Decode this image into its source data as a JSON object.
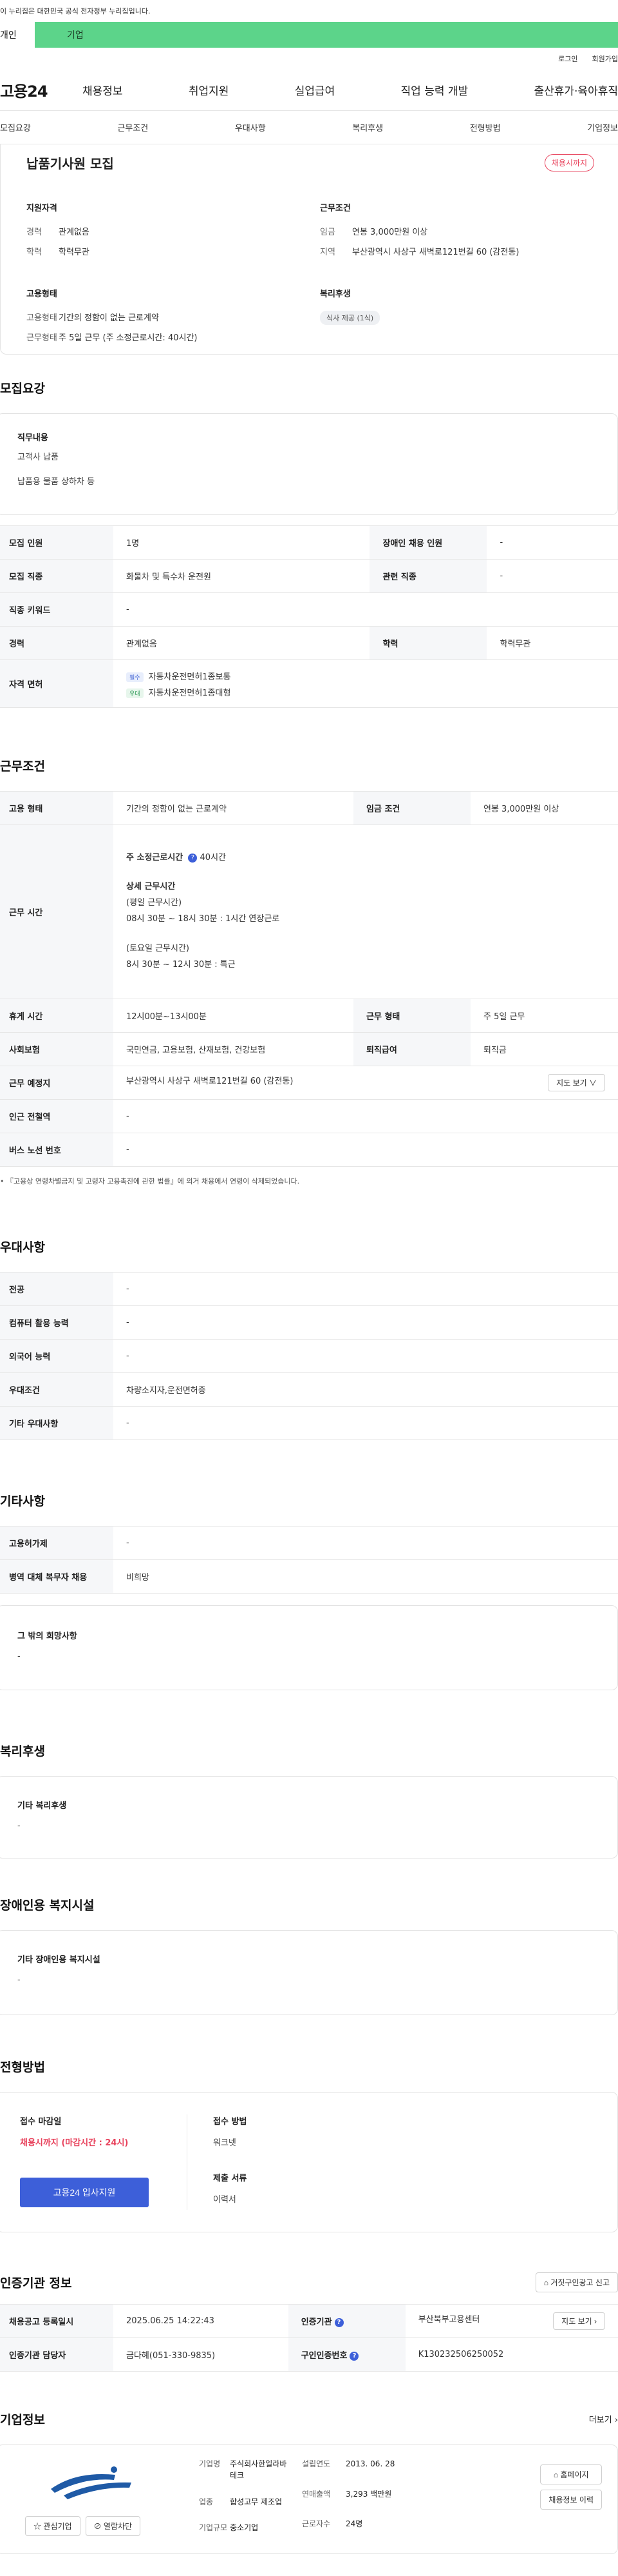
{
  "top": {
    "gov_notice": "이 누리집은 대한민국 공식 전자정부 누리집입니다.",
    "tab_personal": "개인",
    "tab_company": "기업",
    "login": "로그인",
    "join": "회원가입"
  },
  "gnb": {
    "logo": "고용24",
    "items": [
      "채용정보",
      "취업지원",
      "실업급여",
      "직업 능력 개발",
      "출산휴가·육아휴직"
    ]
  },
  "subnav": [
    "모집요강",
    "근무조건",
    "우대사항",
    "복리후생",
    "전형방법",
    "기업정보"
  ],
  "summary": {
    "title": "납품기사원 모집",
    "status_pill": "채용시까지",
    "qual_label": "지원자격",
    "career_k": "경력",
    "career_v": "관계없음",
    "edu_k": "학력",
    "edu_v": "학력무관",
    "cond_label": "근무조건",
    "wage_k": "임금",
    "wage_v": "연봉 3,000만원 이상",
    "region_k": "지역",
    "region_v": "부산광역시 사상구 새벽로121번길 60 (감전동)",
    "emp_label": "고용형태",
    "emptype_k": "고용형태",
    "emptype_v": "기간의 정함이 없는 근로계약",
    "worktype_k": "근무형태",
    "worktype_v": "주 5일 근무 (주 소정근로시간: 40시간)",
    "welfare_label": "복리후생",
    "welfare_chip": "식사 제공 (1식)"
  },
  "recruit": {
    "heading": "모집요강",
    "duty_label": "직무내용",
    "duty_lines": [
      "고객사 납품",
      "납품용 물품 상하차 등"
    ],
    "rows": {
      "count_k": "모집 인원",
      "count_v": "1명",
      "disabled_k": "장애인 채용 인원",
      "disabled_v": "-",
      "job_k": "모집 직종",
      "job_v": "화물차 및 특수차 운전원",
      "related_k": "관련 직종",
      "related_v": "-",
      "keyword_k": "직종 키워드",
      "keyword_v": "-",
      "career_k": "경력",
      "career_v": "관계없음",
      "edu_k": "학력",
      "edu_v": "학력무관",
      "license_k": "자격 면허",
      "license_must_tag": "필수",
      "license_must": "자동차운전면허1종보통",
      "license_pref_tag": "우대",
      "license_pref": "자동차운전면허1종대형"
    }
  },
  "work": {
    "heading": "근무조건",
    "emp_k": "고용 형태",
    "emp_v": "기간의 정함이 없는 근로계약",
    "wage_k": "임금 조건",
    "wage_v": "연봉 3,000만원 이상",
    "hours_k": "근무 시간",
    "hours_title": "주 소정근로시간",
    "hours_value": "40시간",
    "hours_detail_title": "상세 근무시간",
    "hours_lines": [
      "(평일 근무시간)",
      "08시 30분 ~ 18시 30분 : 1시간 연장근로",
      "",
      "(토요일 근무시간)",
      "8시 30분 ~ 12시 30분 : 특근"
    ],
    "rest_k": "휴게 시간",
    "rest_v": "12시00분~13시00분",
    "form_k": "근무 형태",
    "form_v": "주 5일 근무",
    "insurance_k": "사회보험",
    "insurance_v": "국민연금, 고용보험, 산재보험, 건강보험",
    "retire_k": "퇴직급여",
    "retire_v": "퇴직금",
    "place_k": "근무 예정지",
    "place_v": "부산광역시 사상구 새벽로121번길 60 (감전동)",
    "map_btn": "지도 보기 ∨",
    "subway_k": "인근 전철역",
    "subway_v": "-",
    "bus_k": "버스 노선 번호",
    "bus_v": "-",
    "footnote": "『고용상 연령차별금지 및 고령자 고용촉진에 관한 법률』에 의거 채용에서 연령이 삭제되었습니다."
  },
  "pref": {
    "heading": "우대사항",
    "major_k": "전공",
    "major_v": "-",
    "computer_k": "컴퓨터 활용 능력",
    "computer_v": "-",
    "lang_k": "외국어 능력",
    "lang_v": "-",
    "cond_k": "우대조건",
    "cond_v": "차량소지자,운전면허증",
    "etc_k": "기타 우대사항",
    "etc_v": "-"
  },
  "other": {
    "heading": "기타사항",
    "foreign_k": "고용허가제",
    "foreign_v": "-",
    "military_k": "병역 대체 복무자 채용",
    "military_v": "비희망",
    "wish_label": "그 밖의 희망사항",
    "wish_v": "-"
  },
  "welfare": {
    "heading": "복리후생",
    "label": "기타 복리후생",
    "value": "-"
  },
  "facility": {
    "heading": "장애인용 복지시설",
    "label": "기타 장애인용 복지시설",
    "value": "-"
  },
  "apply": {
    "heading": "전형방법",
    "deadline_label": "접수 마감일",
    "deadline_value": "채용시까지 (마감시간 : 24시)",
    "apply_btn": "고용24 입사지원",
    "method_label": "접수 방법",
    "method_value": "워크넷",
    "docs_label": "제출 서류",
    "docs_value": "이력서"
  },
  "cert": {
    "heading": "인증기관 정보",
    "report_btn": "거짓구인광고 신고",
    "date_k": "채용공고 등록일시",
    "date_v": "2025.06.25 14:22:43",
    "agency_k": "인증기관",
    "agency_v": "부산북부고용센터",
    "map_btn": "지도 보기 ›",
    "manager_k": "인증기관 담당자",
    "manager_v": "금다혜(051-330-9835)",
    "cert_no_k": "구인인증번호",
    "cert_no_v": "K130232506250052"
  },
  "company": {
    "heading": "기업정보",
    "more": "더보기 ›",
    "fav_btn": "관심기업",
    "block_btn": "열람차단",
    "name_k": "기업명",
    "name_v1": "주식회사한일라바",
    "name_v2": "테크",
    "industry_k": "업종",
    "industry_v": "합성고무 제조업",
    "scale_k": "기업규모",
    "scale_v": "중소기업",
    "founded_k": "설립연도",
    "founded_v": "2013. 06. 28",
    "sales_k": "연매출액",
    "sales_v": "3,293 백만원",
    "employees_k": "근로자수",
    "employees_v": "24명",
    "homepage_btn": "홈페이지",
    "history_btn": "채용정보 이력"
  },
  "colors": {
    "green_bar": "#5cd48a",
    "accent_red": "#e8425c",
    "primary_blue": "#3d5fd9"
  }
}
